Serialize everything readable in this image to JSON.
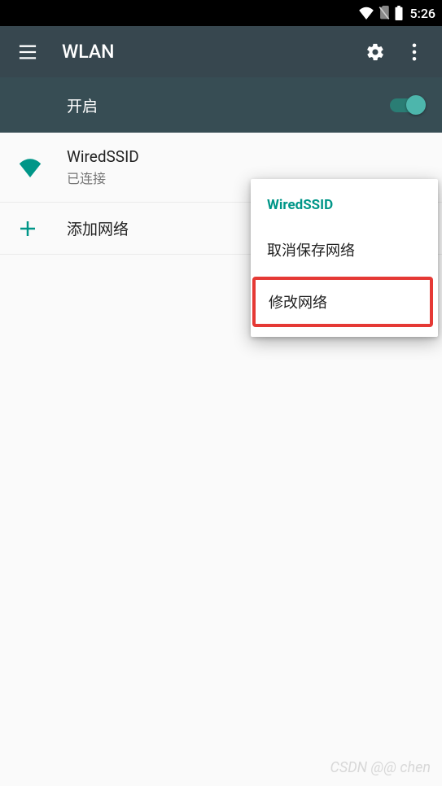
{
  "status": {
    "time": "5:26"
  },
  "appbar": {
    "title": "WLAN"
  },
  "toggle": {
    "label": "开启",
    "enabled": true
  },
  "network": {
    "icon": "wifi-full",
    "ssid": "WiredSSID",
    "status": "已连接"
  },
  "add_network": {
    "label": "添加网络"
  },
  "popup": {
    "title": "WiredSSID",
    "forget_label": "取消保存网络",
    "modify_label": "修改网络"
  },
  "watermark": "CSDN @@ chen"
}
